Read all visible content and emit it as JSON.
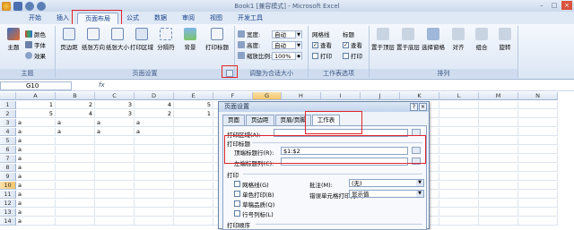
{
  "window": {
    "title": "Book1 [兼容模式] - Microsoft Excel"
  },
  "tabs": [
    "开始",
    "插入",
    "页面布局",
    "公式",
    "数据",
    "审阅",
    "视图",
    "开发工具"
  ],
  "active_tab": "页面布局",
  "ribbon": {
    "theme_group": {
      "title": "主题",
      "big": "主题",
      "small": [
        "颜色",
        "字体",
        "效果"
      ]
    },
    "page_setup_group": {
      "title": "页面设置",
      "buttons": [
        "页边距",
        "纸张方向",
        "纸张大小",
        "打印区域",
        "分隔符",
        "背景",
        "打印标题"
      ]
    },
    "scale_group": {
      "title": "调整为合适大小",
      "rows": [
        {
          "label": "宽度:",
          "value": "自动"
        },
        {
          "label": "高度:",
          "value": "自动"
        },
        {
          "label": "缩放比例:",
          "value": "100%"
        }
      ]
    },
    "sheet_options_group": {
      "title": "工作表选项",
      "grid_label": "网格线",
      "heading_label": "标题",
      "view": "查看",
      "print": "打印"
    },
    "arrange_group": {
      "title": "排列",
      "buttons": [
        "置于顶层",
        "置于底层",
        "选择窗格",
        "对齐",
        "组合",
        "旋转"
      ]
    }
  },
  "formula_bar": {
    "name_box": "G10",
    "fx": "fx"
  },
  "grid": {
    "columns": [
      "A",
      "B",
      "C",
      "D",
      "E",
      "F",
      "G",
      "H",
      "I",
      "J",
      "K",
      "L",
      "M",
      "N"
    ],
    "rows": [
      "1",
      "2",
      "3",
      "4",
      "5",
      "6",
      "7",
      "8",
      "9",
      "10",
      "11",
      "12",
      "13",
      "14"
    ],
    "row1": [
      "1",
      "2",
      "3",
      "4",
      "5"
    ],
    "row2": [
      "5",
      "4",
      "3",
      "2",
      "1"
    ],
    "a": "a"
  },
  "dialog": {
    "title": "页面设置",
    "tabs": [
      "页面",
      "页边距",
      "页眉/页脚",
      "工作表"
    ],
    "active_tab": "工作表",
    "print_area_label": "打印区域(A):",
    "print_titles_label": "打印标题",
    "top_rows_label": "顶端标题行(R):",
    "top_rows_value": "$1:$2",
    "left_cols_label": "左端标题列(C):",
    "print_label": "打印",
    "checkboxes": [
      "网格线(G)",
      "单色打印(B)",
      "草稿品质(Q)",
      "行号列标(L)"
    ],
    "comments_label": "批注(M):",
    "comments_value": "(无)",
    "errors_label": "错误单元格打印为(E):",
    "errors_value": "显示值",
    "order_label": "打印顺序"
  }
}
